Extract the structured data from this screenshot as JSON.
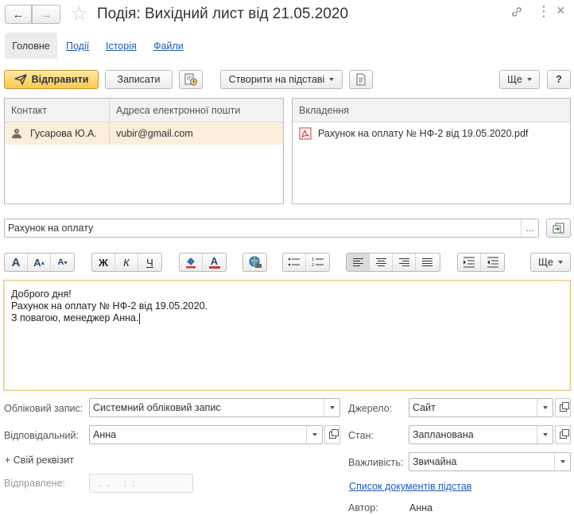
{
  "window": {
    "title": "Подія: Вихідний лист від 21.05.2020"
  },
  "tabs": [
    {
      "label": "Головне",
      "active": true
    },
    {
      "label": "Події"
    },
    {
      "label": "Історія"
    },
    {
      "label": "Файли"
    }
  ],
  "toolbar": {
    "send_label": "Відправити",
    "save_label": "Записати",
    "create_based_label": "Створити на підставі",
    "more_label": "Ще",
    "help_label": "?"
  },
  "contacts": {
    "columns": [
      "Контакт",
      "Адреса електронної пошти"
    ],
    "rows": [
      {
        "contact": "Гусарова Ю.А.",
        "email": "vubir@gmail.com"
      }
    ]
  },
  "attachments": {
    "column": "Вкладення",
    "rows": [
      {
        "name": "Рахунок на оплату № НФ-2 від 19.05.2020.pdf"
      }
    ]
  },
  "subject": {
    "value": "Рахунок на оплату",
    "select_label": "..."
  },
  "editor": {
    "more_label": "Ще",
    "bold": "Ж",
    "italic": "К",
    "underline": "Ч",
    "lines": [
      "Доброго дня!",
      "Рахунок на оплату № НФ-2 від 19.05.2020.",
      "З повагою, менеджер Анна."
    ]
  },
  "form": {
    "account_label": "Обліковий запис:",
    "account_value": "Системний обліковий запис",
    "responsible_label": "Відповідальний:",
    "responsible_value": "Анна",
    "custom_attr_label": "+ Свій реквізит",
    "sent_label": "Відправлене:",
    "sent_value": " .  .     :  :",
    "source_label": "Джерело:",
    "source_value": "Сайт",
    "state_label": "Стан:",
    "state_value": "Запланована",
    "importance_label": "Важливість:",
    "importance_value": "Звичайна",
    "basis_docs_link": "Список документів підстав",
    "author_label": "Автор:",
    "author_value": "Анна"
  },
  "colors": {
    "accent_yellow": "#f8c94d",
    "link": "#1e5bb8",
    "selection": "#fbeedb",
    "editor_border": "#e6c97a"
  }
}
